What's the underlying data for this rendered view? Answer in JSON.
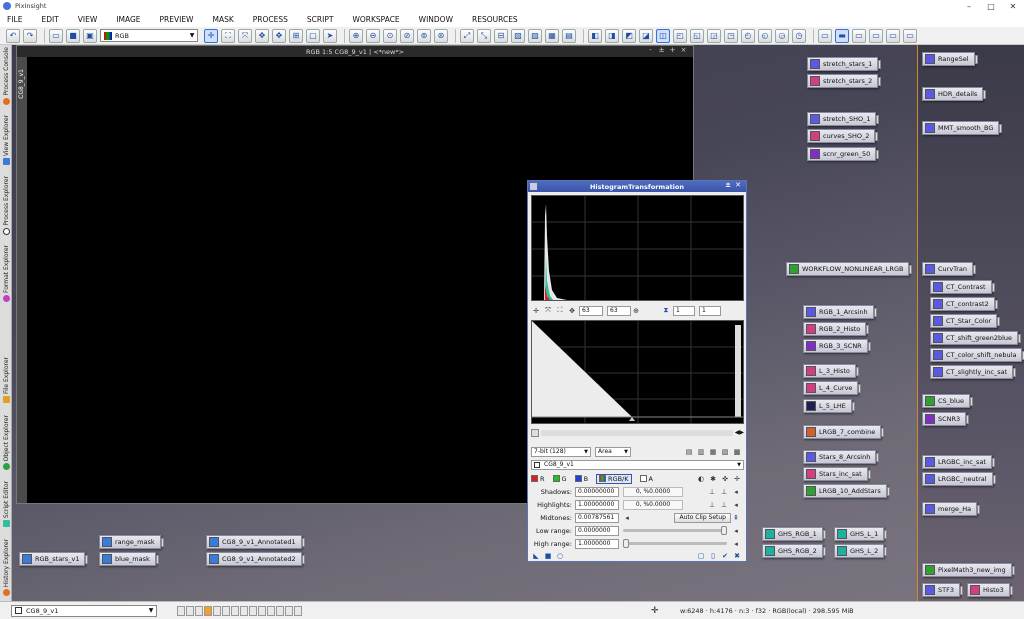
{
  "app": {
    "title": "PixInsight",
    "window_controls": [
      "–",
      "□",
      "✕"
    ]
  },
  "menu": [
    "FILE",
    "EDIT",
    "VIEW",
    "IMAGE",
    "PREVIEW",
    "MASK",
    "PROCESS",
    "SCRIPT",
    "WORKSPACE",
    "WINDOW",
    "RESOURCES"
  ],
  "toolbar": {
    "channel_select": "RGB"
  },
  "sidebar_tabs": [
    "Process Console",
    "View Explorer",
    "Process Explorer",
    "Format Explorer",
    "File Explorer",
    "Object Explorer",
    "Script Editor",
    "History Explorer"
  ],
  "image_window": {
    "title": "RGB 1:5 CG8_9_v1 | <*new*>",
    "view_tab": "CG8_9_v1",
    "controls": [
      "-",
      "±",
      "+",
      "×"
    ]
  },
  "histogram": {
    "title": "HistogramTransformation",
    "zoom_x": "63",
    "zoom_y": "63",
    "scale_a": "1",
    "scale_b": "1",
    "bit_depth": "7-bit (128)",
    "graph_mode": "Area",
    "view": "CG8_9_v1",
    "channels": {
      "r": "R",
      "g": "G",
      "b": "B",
      "rgbk": "RGB/K",
      "a": "A"
    },
    "shadows": {
      "label": "Shadows:",
      "value": "0.00000000",
      "pct": "0, %0.0000"
    },
    "highlights": {
      "label": "Highlights:",
      "value": "1.00000000",
      "pct": "0, %0.0000"
    },
    "midtones": {
      "label": "Midtones:",
      "value": "0.00787561"
    },
    "auto_clip": "Auto Clip Setup",
    "low_range": {
      "label": "Low range:",
      "value": "0.0000000"
    },
    "high_range": {
      "label": "High range:",
      "value": "1.0000000"
    }
  },
  "process_icons": [
    "stretch_stars_1",
    "stretch_stars_2",
    "stretch_SHO_1",
    "curves_SHO_2",
    "scnr_green_50",
    "WORKFLOW_NONLINEAR_LRGB",
    "RGB_1_Arcsinh",
    "RGB_2_Histo",
    "RGB_3_SCNR",
    "L_3_Histo",
    "L_4_Curve",
    "L_5_LHE",
    "LRGB_7_combine",
    "Stars_8_Arcsinh",
    "Stars_inc_sat",
    "LRGB_10_AddStars",
    "GHS_RGB_1",
    "GHS_RGB_2",
    "GHS_L_1",
    "GHS_L_2",
    "range_mask",
    "blue_mask",
    "RGB_stars_v1",
    "CG8_9_v1_Annotated1",
    "CG8_9_v1_Annotated2",
    "RangeSel",
    "HDR_details",
    "MMT_smooth_BG",
    "CurvTran",
    "CT_Contrast",
    "CT_contrast2",
    "CT_Star_Color",
    "CT_shift_green2blue",
    "CT_color_shift_nebula",
    "CT_slightly_inc_sat",
    "CS_blue",
    "SCNR3",
    "LRGBC_inc_sat",
    "LRGBC_neutral",
    "merge_Ha",
    "PixelMath3_new_img",
    "STF3",
    "Histo3"
  ],
  "status": {
    "view": "CG8_9_v1",
    "text": "w:6248 · h:4176 · n:3 · f32 · RGB(local) · 298.595 MiB"
  },
  "colors": {
    "accent": "#3a55a8",
    "workspace": "#4a4858",
    "divider": "#d08a2a"
  }
}
